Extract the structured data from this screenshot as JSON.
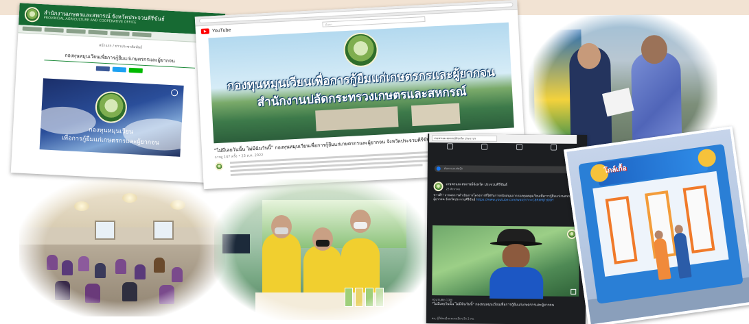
{
  "collage": {
    "website": {
      "org_name": "สำนักงานเกษตรและสหกรณ์ จังหวัดประจวบคีรีขันธ์",
      "org_name_en": "PROVINCIAL AGRICULTURE AND COOPERATIVE OFFICE",
      "breadcrumb": "หน้าแรก / ข่าวประชาสัมพันธ์",
      "article_title": "กองทุนหมุนเวียนเพื่อการกู้ยืมแก่เกษตรกรและผู้ยากจน",
      "banner_line1": "กองทุนหมุนเวียน",
      "banner_line2": "เพื่อการกู้ยืมแก่เกษตรกรและผู้ยากจน"
    },
    "youtube": {
      "brand": "YouTube",
      "search_placeholder": "ค้นหา",
      "banner_line1": "กองทุนหมุนเวียนเพื่อการกู้ยืมแก่เกษตรกรและผู้ยากจน",
      "banner_line2": "สำนักงานปลัดกระทรวงเกษตรและสหกรณ์",
      "video_title": "\"ไม่มีเลยวันนั้น ไม่มีฉันวันนี้\" กองทุนหมุนเวียนเพื่อการกู้ยืมแก่เกษตรกรและผู้ยากจน จังหวัดประจวบคีรีขันธ์",
      "video_meta": "การดู 147 ครั้ง • 23 ส.ค. 2022"
    },
    "facebook": {
      "tab_label": "เกษตรและสหกรณ์จังหวัด ประจวบฯ",
      "search_placeholder": "ค้นหาบนเฟซบุ๊ก",
      "page_name": "เกษตรและสหกรณ์จังหวัด ประจวบคีรีขันธ์",
      "post_date": "23 สิงหาคม",
      "post_body": "ชาวดี!! จากผลการดำเนินการโครงการที่ได้รับการสนับสนุนจากกองทุนหมุนเวียนเพื่อการกู้ยืมแก่เกษตรกรและผู้ยากจน จังหวัดประจวบคีรีขันธ์",
      "post_link": "https://www.youtube.com/watch?v=C8RkMjTd0DY",
      "source": "YOUTUBE.COM",
      "video_caption": "\"ไม่มีเลยวันนั้น ไม่มีฉันวันนี้\" กองทุนหมุนเวียนเพื่อการกู้ยืมแก่เกษตรกรและผู้ยากจน",
      "footer": "ผม, ผู้ใช้คนอื่นและคนอื่นๆ อีก 2 คน"
    },
    "booth_sign": "โกล์เกื้อ"
  },
  "colors": {
    "header_green": "#176a33",
    "youtube_red": "#ff0000",
    "facebook_dark": "#1c1e21",
    "link_blue": "#4599ff",
    "shirt_yellow": "#f1cf2f",
    "frame_blue": "#2a7fd6",
    "peach_band": "#f2e3d3"
  }
}
